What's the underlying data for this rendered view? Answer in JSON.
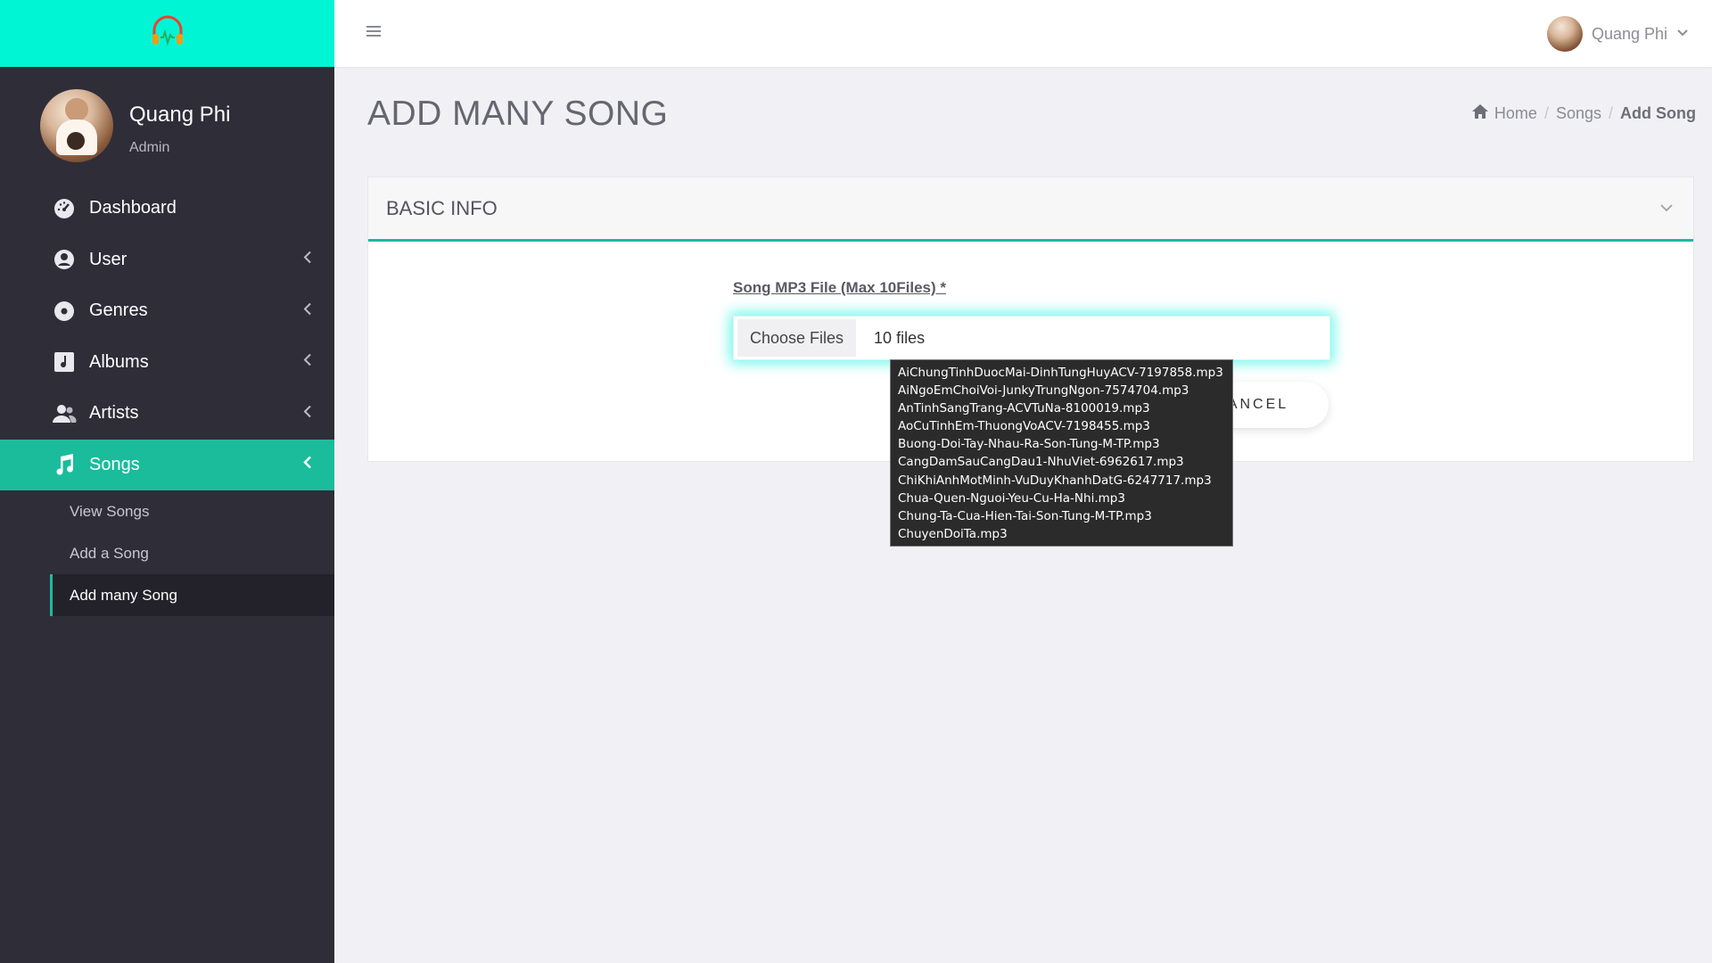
{
  "sidebar": {
    "profile": {
      "name": "Quang Phi",
      "role": "Admin"
    },
    "items": [
      {
        "label": "Dashboard"
      },
      {
        "label": "User"
      },
      {
        "label": "Genres"
      },
      {
        "label": "Albums"
      },
      {
        "label": "Artists"
      },
      {
        "label": "Songs"
      }
    ],
    "songs_submenu": [
      {
        "label": "View Songs"
      },
      {
        "label": "Add a Song"
      },
      {
        "label": "Add many Song"
      }
    ]
  },
  "topbar": {
    "user_name": "Quang Phi"
  },
  "page": {
    "title": "ADD MANY SONG",
    "breadcrumb": {
      "home": "Home",
      "songs": "Songs",
      "current": "Add Song",
      "separator": "/"
    }
  },
  "card": {
    "title": "BASIC INFO",
    "field_label": "Song MP3 File (Max 10Files) *",
    "choose_files_label": "Choose Files",
    "file_count": "10 files",
    "cancel_label": "ANCEL"
  },
  "tooltip": {
    "files": [
      "AiChungTinhDuocMai-DinhTungHuyACV-7197858.mp3",
      "AiNgoEmChoiVoi-JunkyTrungNgon-7574704.mp3",
      "AnTinhSangTrang-ACVTuNa-8100019.mp3",
      "AoCuTinhEm-ThuongVoACV-7198455.mp3",
      "Buong-Doi-Tay-Nhau-Ra-Son-Tung-M-TP.mp3",
      "CangDamSauCangDau1-NhuViet-6962617.mp3",
      "ChiKhiAnhMotMinh-VuDuyKhanhDatG-6247717.mp3",
      "Chua-Quen-Nguoi-Yeu-Cu-Ha-Nhi.mp3",
      "Chung-Ta-Cua-Hien-Tai-Son-Tung-M-TP.mp3",
      "ChuyenDoiTa.mp3"
    ]
  },
  "colors": {
    "brand": "#00f5d4",
    "accent": "#1abc9c",
    "sidebar_bg": "#2f2d38",
    "page_bg": "#f1f1f5"
  },
  "icons": {
    "brand": "headphones-logo-icon",
    "dashboard": "speedometer-icon",
    "user": "user-circle-icon",
    "genres": "disc-icon",
    "albums": "album-music-icon",
    "artists": "users-icon",
    "songs": "music-note-icon",
    "chevron": "chevron-left-icon",
    "home": "home-icon"
  }
}
